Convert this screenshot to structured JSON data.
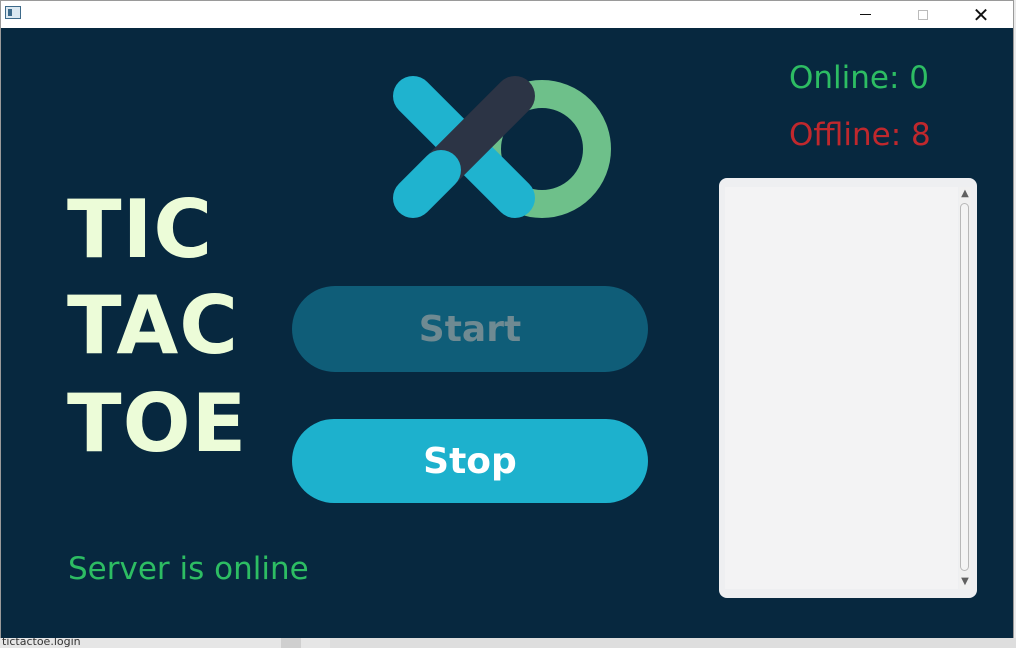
{
  "window": {
    "controls": {
      "minimize": "minimize",
      "maximize": "maximize",
      "close": "✕"
    }
  },
  "title": {
    "line1": "TIC",
    "line2": "TAC",
    "line3": "TOE"
  },
  "logo": {
    "x_color": "#1fb3cf",
    "x_dark_color": "#2c3445",
    "o_color": "#6ec08a"
  },
  "buttons": {
    "start_label": "Start",
    "stop_label": "Stop"
  },
  "stats": {
    "online_label": "Online: 0",
    "offline_label": "Offline: 8"
  },
  "status": {
    "text": "Server is online"
  },
  "scrollbar": {
    "up": "▲",
    "down": "▼"
  },
  "background": {
    "filename": "tictactoe.login"
  },
  "colors": {
    "background": "#07283f",
    "title": "#ecfcd8",
    "online": "#2dbd63",
    "offline": "#c0282d",
    "start_button": "#0f5d78",
    "stop_button": "#1db1cd"
  }
}
